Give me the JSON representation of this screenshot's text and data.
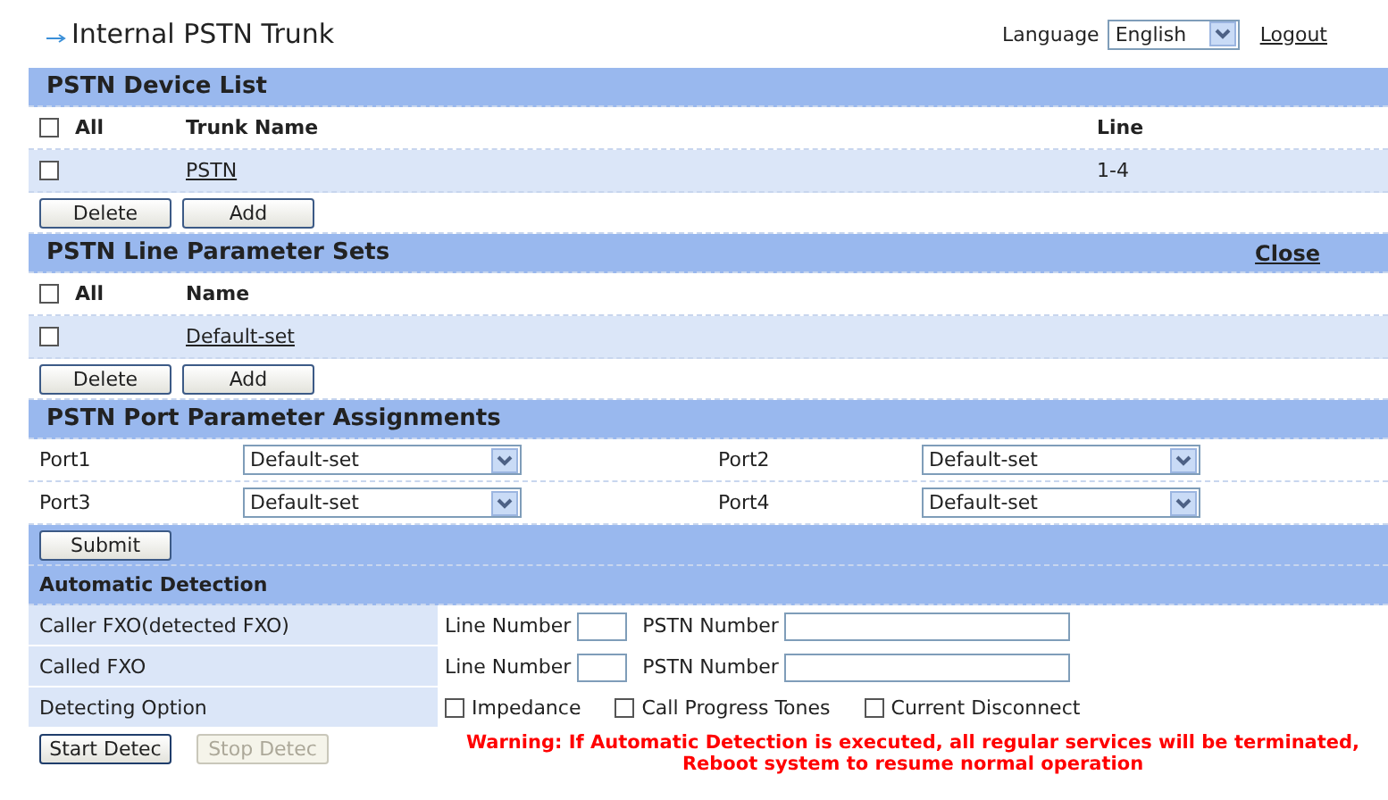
{
  "title": "Internal PSTN Trunk",
  "language": {
    "label": "Language",
    "value": "English"
  },
  "logout": "Logout",
  "device_list": {
    "title": "PSTN Device List",
    "all_label": "All",
    "all_checked": false,
    "columns": [
      "Trunk Name",
      "Line"
    ],
    "rows": [
      {
        "checked": false,
        "name": "PSTN",
        "line": "1-4"
      }
    ],
    "buttons": [
      "Delete",
      "Add"
    ]
  },
  "line_sets": {
    "title": "PSTN Line Parameter Sets",
    "close": "Close",
    "all_label": "All",
    "all_checked": false,
    "columns": [
      "Name"
    ],
    "rows": [
      {
        "checked": false,
        "name": "Default-set"
      }
    ],
    "buttons": [
      "Delete",
      "Add"
    ]
  },
  "port_assignments": {
    "title": "PSTN Port Parameter Assignments",
    "ports": [
      {
        "label": "Port1",
        "value": "Default-set"
      },
      {
        "label": "Port2",
        "value": "Default-set"
      },
      {
        "label": "Port3",
        "value": "Default-set"
      },
      {
        "label": "Port4",
        "value": "Default-set"
      }
    ],
    "submit": "Submit"
  },
  "auto_detection": {
    "title": "Automatic Detection",
    "rows": [
      {
        "label": "Caller FXO(detected FXO)",
        "line_label": "Line Number",
        "pstn_label": "PSTN Number"
      },
      {
        "label": "Called FXO",
        "line_label": "Line Number",
        "pstn_label": "PSTN Number"
      }
    ],
    "option_label": "Detecting Option",
    "options": [
      {
        "label": "Impedance",
        "checked": false
      },
      {
        "label": "Call Progress Tones",
        "checked": false
      },
      {
        "label": "Current Disconnect",
        "checked": false
      }
    ],
    "buttons": [
      {
        "label": "Start Detec",
        "disabled": false
      },
      {
        "label": "Stop  Detec",
        "disabled": true
      }
    ],
    "warning": [
      "Warning: If Automatic Detection is executed, all regular services will be terminated,",
      "Reboot system to resume normal operation"
    ]
  }
}
